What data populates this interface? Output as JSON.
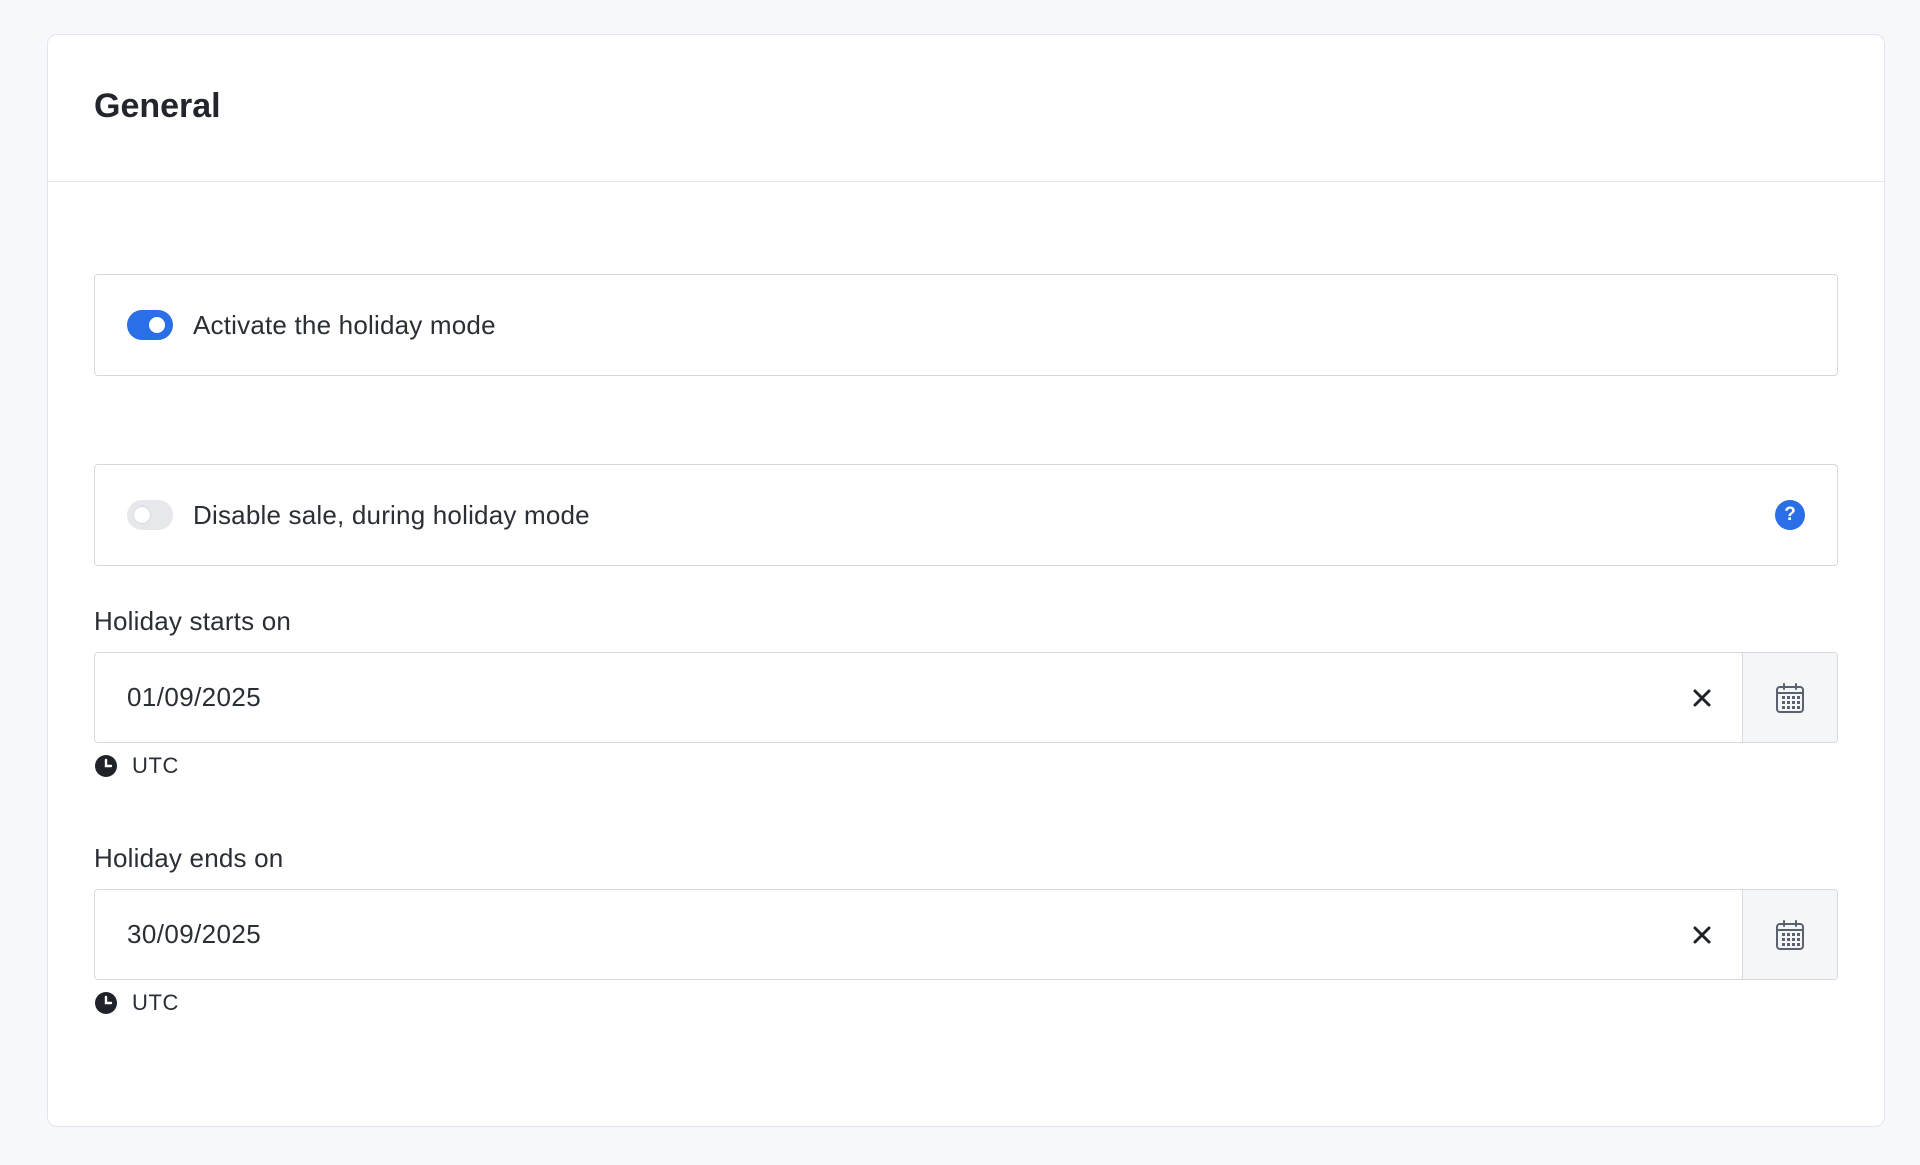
{
  "section": {
    "title": "General"
  },
  "toggles": [
    {
      "label": "Activate the holiday mode",
      "state": "on"
    },
    {
      "label": "Disable sale, during holiday mode",
      "state": "off",
      "help_icon": "question-circle-icon"
    }
  ],
  "fields": [
    {
      "label": "Holiday starts on",
      "value": "01/09/2025",
      "timezone": "UTC"
    },
    {
      "label": "Holiday ends on",
      "value": "30/09/2025",
      "timezone": "UTC"
    }
  ],
  "help_glyph": "?",
  "colors": {
    "accent": "#2b6fe6",
    "background": "#f7f8fc",
    "border": "#d6d9e0",
    "text": "#2a2e35"
  }
}
